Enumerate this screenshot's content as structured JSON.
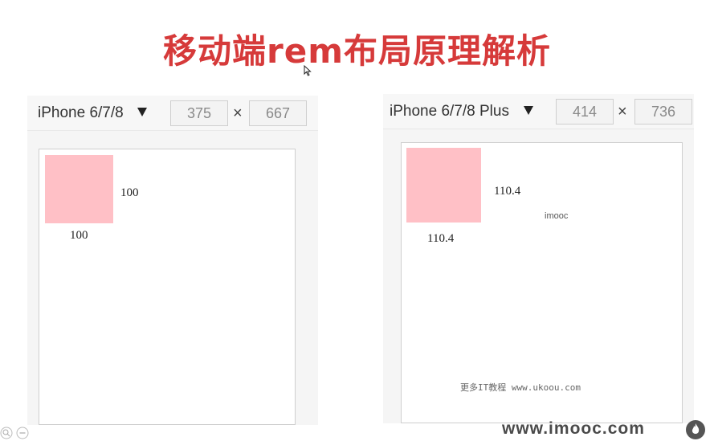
{
  "title": "移动端rem布局原理解析",
  "left_device": {
    "name": "iPhone 6/7/8",
    "width": "375",
    "height": "667",
    "times": "×",
    "box_width_label": "100",
    "box_height_label": "100"
  },
  "right_device": {
    "name": "iPhone 6/7/8 Plus",
    "width": "414",
    "height": "736",
    "times": "×",
    "box_width_label": "110.4",
    "box_height_label": "110.4",
    "logo_text": "imooc",
    "watermark": "更多IT教程 www.ukoou.com"
  },
  "footer": {
    "url": "www.imooc.com"
  },
  "colors": {
    "title": "#d63a3a",
    "pink_box": "#ffc0c6"
  },
  "icons": {
    "cursor": "cursor-arrow-icon",
    "zoom": "zoom-icon",
    "more": "more-icon",
    "flame": "flame-logo-icon"
  }
}
